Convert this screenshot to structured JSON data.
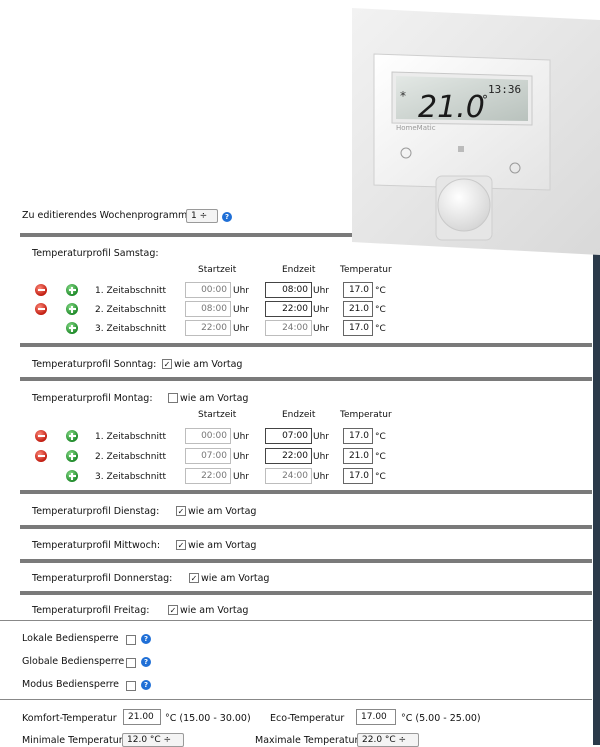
{
  "device": {
    "brand": "HomeMatic",
    "display_temp": "21.0",
    "display_unit": "°",
    "display_time": "13:36",
    "display_mode": "Auto"
  },
  "program": {
    "label": "Zu editierendes Wochenprogramm:",
    "selected": "1"
  },
  "columns": {
    "start": "Startzeit",
    "end": "Endzeit",
    "temp": "Temperatur"
  },
  "unit_time": "Uhr",
  "unit_temp": "°C",
  "same_as_prev": "wie am Vortag",
  "saturday": {
    "title": "Temperaturprofil Samstag:",
    "rows": [
      {
        "label": "1. Zeitabschnitt",
        "start": "00:00",
        "end": "08:00",
        "temp": "17.0"
      },
      {
        "label": "2. Zeitabschnitt",
        "start": "08:00",
        "end": "22:00",
        "temp": "21.0"
      },
      {
        "label": "3. Zeitabschnitt",
        "start": "22:00",
        "end": "24:00",
        "temp": "17.0"
      }
    ]
  },
  "sunday": {
    "title": "Temperaturprofil Sonntag:",
    "same": true
  },
  "monday": {
    "title": "Temperaturprofil Montag:",
    "same": false,
    "rows": [
      {
        "label": "1. Zeitabschnitt",
        "start": "00:00",
        "end": "07:00",
        "temp": "17.0"
      },
      {
        "label": "2. Zeitabschnitt",
        "start": "07:00",
        "end": "22:00",
        "temp": "21.0"
      },
      {
        "label": "3. Zeitabschnitt",
        "start": "22:00",
        "end": "24:00",
        "temp": "17.0"
      }
    ]
  },
  "tuesday": {
    "title": "Temperaturprofil Dienstag:",
    "same": true
  },
  "wednesday": {
    "title": "Temperaturprofil Mittwoch:",
    "same": true
  },
  "thursday": {
    "title": "Temperaturprofil Donnerstag:",
    "same": true
  },
  "friday": {
    "title": "Temperaturprofil Freitag:",
    "same": true
  },
  "locks": {
    "local": "Lokale Bediensperre",
    "global": "Globale Bediensperre",
    "mode": "Modus Bediensperre"
  },
  "bottom": {
    "comfort_label": "Komfort-Temperatur",
    "comfort_value": "21.00",
    "comfort_range": "°C (15.00 - 30.00)",
    "eco_label": "Eco-Temperatur",
    "eco_value": "17.00",
    "eco_range": "°C (5.00 - 25.00)",
    "min_label": "Minimale Temperatur",
    "min_value": "12.0 °C",
    "max_label": "Maximale Temperatur",
    "max_value": "22.0 °C"
  },
  "colors": {
    "separator": "#7a7a7a",
    "help": "#1f6fd6",
    "minus": "#c01c10",
    "plus": "#1f8a2a"
  }
}
